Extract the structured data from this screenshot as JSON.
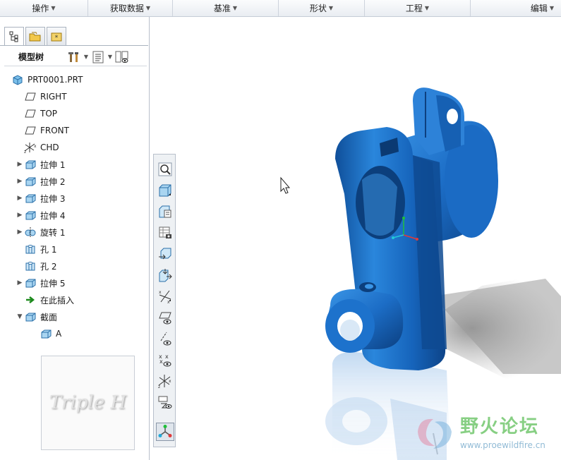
{
  "menubar": {
    "items": [
      {
        "label": "操作"
      },
      {
        "label": "获取数据"
      },
      {
        "label": "基准"
      },
      {
        "label": "形状"
      },
      {
        "label": "工程"
      },
      {
        "label": "编辑"
      }
    ]
  },
  "model_tree": {
    "title": "模型树",
    "root": "PRT0001.PRT",
    "items": [
      {
        "label": "RIGHT",
        "icon": "datum-plane-icon"
      },
      {
        "label": "TOP",
        "icon": "datum-plane-icon"
      },
      {
        "label": "FRONT",
        "icon": "datum-plane-icon"
      },
      {
        "label": "CHD",
        "icon": "coordinate-system-icon"
      },
      {
        "label": "拉伸 1",
        "icon": "extrude-icon"
      },
      {
        "label": "拉伸 2",
        "icon": "extrude-icon"
      },
      {
        "label": "拉伸 3",
        "icon": "extrude-icon"
      },
      {
        "label": "拉伸 4",
        "icon": "extrude-icon"
      },
      {
        "label": "旋转 1",
        "icon": "revolve-icon"
      },
      {
        "label": "孔 1",
        "icon": "hole-icon"
      },
      {
        "label": "孔 2",
        "icon": "hole-icon"
      },
      {
        "label": "拉伸 5",
        "icon": "extrude-icon"
      },
      {
        "label": "在此插入",
        "icon": "insert-here-icon"
      },
      {
        "label": "截面",
        "icon": "section-icon"
      },
      {
        "label": "A",
        "icon": "section-icon"
      }
    ]
  },
  "thumbnail": {
    "text": "Triple H"
  },
  "watermark": {
    "title": "野火论坛",
    "url": "www.proewildfire.cn"
  },
  "colors": {
    "model": "#1b6bc4",
    "accent": "#2f7fd8"
  }
}
